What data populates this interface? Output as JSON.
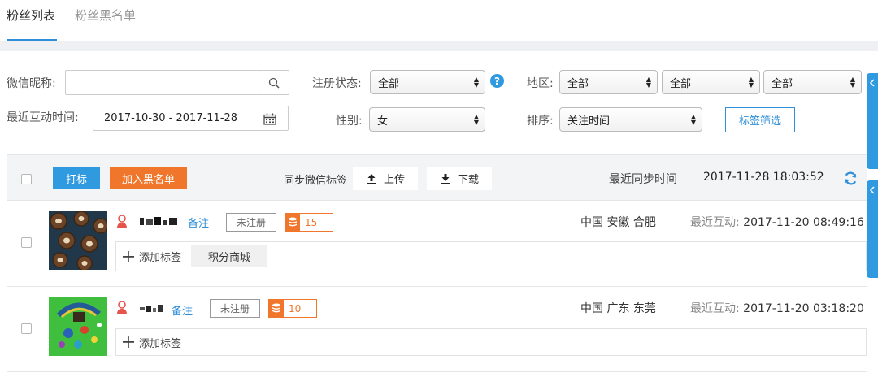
{
  "tabs": [
    {
      "label": "粉丝列表",
      "active": true
    },
    {
      "label": "粉丝黑名单",
      "active": false
    }
  ],
  "filters": {
    "nickname_label": "微信昵称:",
    "nickname_value": "",
    "reg_status_label": "注册状态:",
    "reg_status_value": "全部",
    "region_label": "地区:",
    "region_values": [
      "全部",
      "全部",
      "全部"
    ],
    "interaction_label": "最近互动时间:",
    "interaction_range": "2017-10-30 - 2017-11-28",
    "gender_label": "性别:",
    "gender_value": "女",
    "sort_label": "排序:",
    "sort_value": "关注时间",
    "tag_filter_button": "标签筛选"
  },
  "toolbar": {
    "mark_button": "打标",
    "blacklist_button": "加入黑名单",
    "sync_label": "同步微信标签",
    "upload_button": "上传",
    "download_button": "下载",
    "last_sync_label": "最近同步时间",
    "last_sync_time": "2017-11-28 18:03:52"
  },
  "fans": [
    {
      "remark": "备注",
      "status": "未注册",
      "points": "15",
      "location": "中国 安徽 合肥",
      "last_interaction_label": "最近互动:",
      "last_interaction": "2017-11-20 08:49:16",
      "add_tag": "添加标签",
      "tags": [
        "积分商城"
      ]
    },
    {
      "remark": "备注",
      "status": "未注册",
      "points": "10",
      "location": "中国 广东 东莞",
      "last_interaction_label": "最近互动:",
      "last_interaction": "2017-11-20 03:18:20",
      "add_tag": "添加标签",
      "tags": []
    }
  ],
  "colors": {
    "accent_blue": "#2f8fd8",
    "orange": "#f0762b",
    "help_blue": "#2f9ae0"
  }
}
